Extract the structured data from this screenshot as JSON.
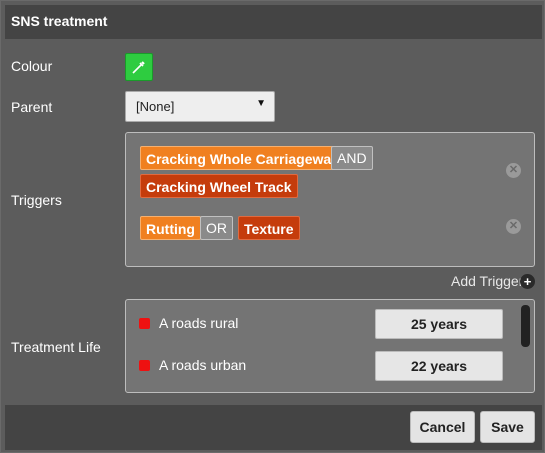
{
  "dialog": {
    "title": "SNS treatment"
  },
  "fields": {
    "colour_label": "Colour",
    "colour_value": "#2ecc40",
    "parent_label": "Parent",
    "parent_value": "[None]",
    "triggers_label": "Triggers",
    "treatment_life_label": "Treatment Life"
  },
  "triggers": {
    "rows": [
      {
        "line1": {
          "a": "Cracking Whole Carriageway",
          "op": "AND"
        },
        "line2": {
          "b": "Cracking Wheel Track"
        }
      },
      {
        "a": "Rutting",
        "op": "OR",
        "b": "Texture"
      }
    ],
    "add_label": "Add Trigger"
  },
  "treatment_life": {
    "rows": [
      {
        "label": "A roads rural",
        "value": "25 years"
      },
      {
        "label": "A roads urban",
        "value": "22 years"
      }
    ]
  },
  "buttons": {
    "cancel": "Cancel",
    "save": "Save"
  },
  "colors": {
    "accent_orange": "#f08020",
    "accent_red": "#c53c0c",
    "status_red": "#ee1111"
  }
}
